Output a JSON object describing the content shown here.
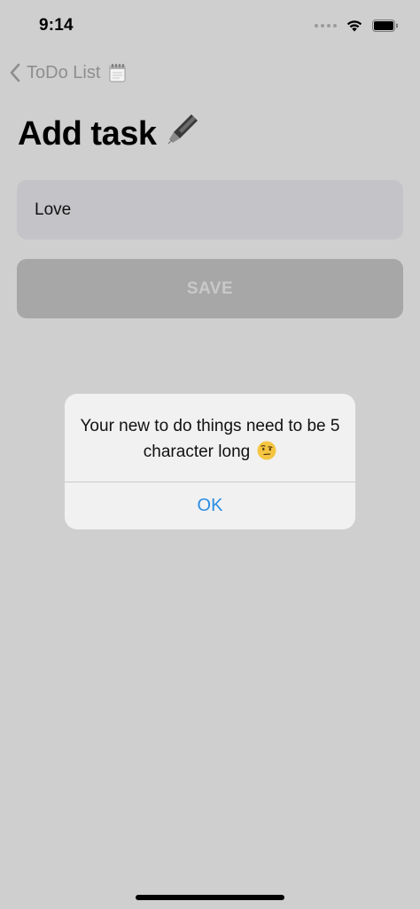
{
  "status_bar": {
    "time": "9:14"
  },
  "nav": {
    "back_label": "ToDo List",
    "back_icon": "chevron-left-icon",
    "notepad_icon": "notepad-emoji"
  },
  "page": {
    "title": "Add task",
    "title_icon": "fountain-pen-emoji"
  },
  "form": {
    "task_value": "Love",
    "save_label": "SAVE"
  },
  "alert": {
    "message": "Your new to do things need to be 5 character long",
    "message_emoji": "face-with-raised-eyebrow-emoji",
    "ok_label": "OK"
  },
  "colors": {
    "background": "#cfcfcf",
    "input_bg": "#c4c4c8",
    "save_bg": "#a7a7a7",
    "alert_bg": "#f1f1f1",
    "accent": "#2b8de4"
  }
}
